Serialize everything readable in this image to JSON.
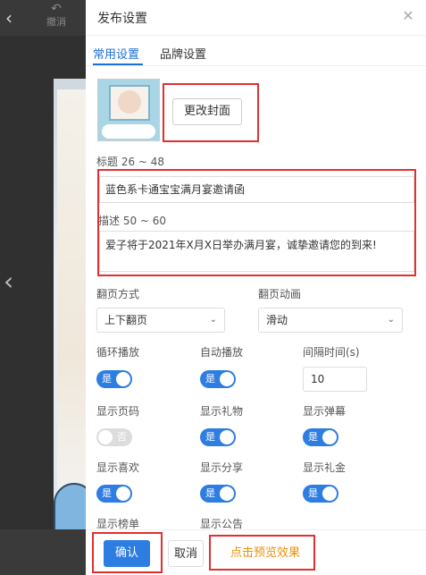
{
  "editor": {
    "undo_label": "撤消"
  },
  "panel": {
    "title": "发布设置",
    "tabs": [
      {
        "label": "常用设置",
        "active": true
      },
      {
        "label": "品牌设置",
        "active": false
      }
    ],
    "change_cover_label": "更改封面",
    "title_label": "标题 26 ~ 48",
    "title_value": "蓝色系卡通宝宝满月宴邀请函",
    "desc_label": "描述 50 ~ 60",
    "desc_value": "爱子将于2021年X月X日举办满月宴，诚挚邀请您的到来!",
    "flip_mode_label": "翻页方式",
    "flip_mode_value": "上下翻页",
    "flip_anim_label": "翻页动画",
    "flip_anim_value": "滑动",
    "toggles": {
      "loop": {
        "label": "循环播放",
        "state": "是"
      },
      "autoplay": {
        "label": "自动播放",
        "state": "是"
      },
      "interval": {
        "label": "间隔时间(s)",
        "value": "10"
      },
      "page_num": {
        "label": "显示页码",
        "state": "否"
      },
      "gift": {
        "label": "显示礼物",
        "state": "是"
      },
      "danmaku": {
        "label": "显示弹幕",
        "state": "是"
      },
      "like": {
        "label": "显示喜欢",
        "state": "是"
      },
      "share": {
        "label": "显示分享",
        "state": "是"
      },
      "money_gift": {
        "label": "显示礼金",
        "state": "是"
      },
      "ranking": {
        "label": "显示榜单"
      },
      "notice": {
        "label": "显示公告"
      }
    },
    "footer": {
      "confirm": "确认",
      "cancel": "取消",
      "preview": "点击预览效果"
    }
  },
  "colors": {
    "accent": "#2d7de2",
    "tab_active": "#1e6fd9",
    "preview_link": "#e8920a",
    "highlight_box": "#e03030"
  }
}
